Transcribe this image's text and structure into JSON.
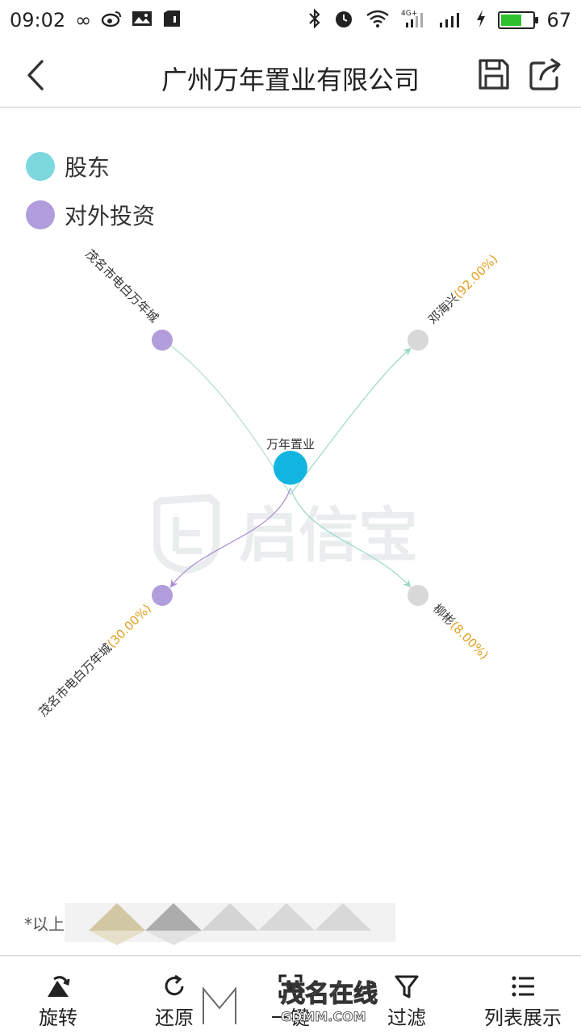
{
  "status_bar": {
    "time": "09:02",
    "battery": "67",
    "battery_level": 0.67,
    "icons_left": [
      "infinity-icon",
      "weibo-icon",
      "image-icon",
      "sim-icon"
    ],
    "icons_right": [
      "bluetooth-icon",
      "alarm-icon",
      "wifi-icon",
      "signal-4g-icon",
      "signal-icon",
      "charging-icon",
      "battery-icon"
    ]
  },
  "header": {
    "title": "广州万年置业有限公司",
    "back_icon": "chevron-left-icon",
    "save_icon": "save-icon",
    "share_icon": "share-icon"
  },
  "legend": [
    {
      "label": "股东",
      "color": "#7dd8de"
    },
    {
      "label": "对外投资",
      "color": "#b29ddc"
    }
  ],
  "graph": {
    "center": {
      "label": "万年置业",
      "color": "#12b5e0"
    },
    "nodes": [
      {
        "name": "茂名市电白万年城",
        "percent": "",
        "role": "investment",
        "color": "#b29ddc"
      },
      {
        "name": "邓海兴",
        "percent": "(92.00%)",
        "role": "shareholder",
        "color": "#d8d8d8"
      },
      {
        "name": "茂名市电白万年城",
        "percent": "(30.00%)",
        "role": "investment",
        "color": "#b29ddc"
      },
      {
        "name": "柳彬",
        "percent": "(8.00%)",
        "role": "shareholder",
        "color": "#d8d8d8"
      }
    ]
  },
  "watermark": {
    "text": "启信宝"
  },
  "footnote": {
    "text": "*以上"
  },
  "toolbar": {
    "rotate": "旋转",
    "reset": "还原",
    "middle": "一键",
    "filter": "过滤",
    "list": "列表展示"
  },
  "overlay_watermark": {
    "text": "茂名在线",
    "sub": "GDMM.COM"
  }
}
